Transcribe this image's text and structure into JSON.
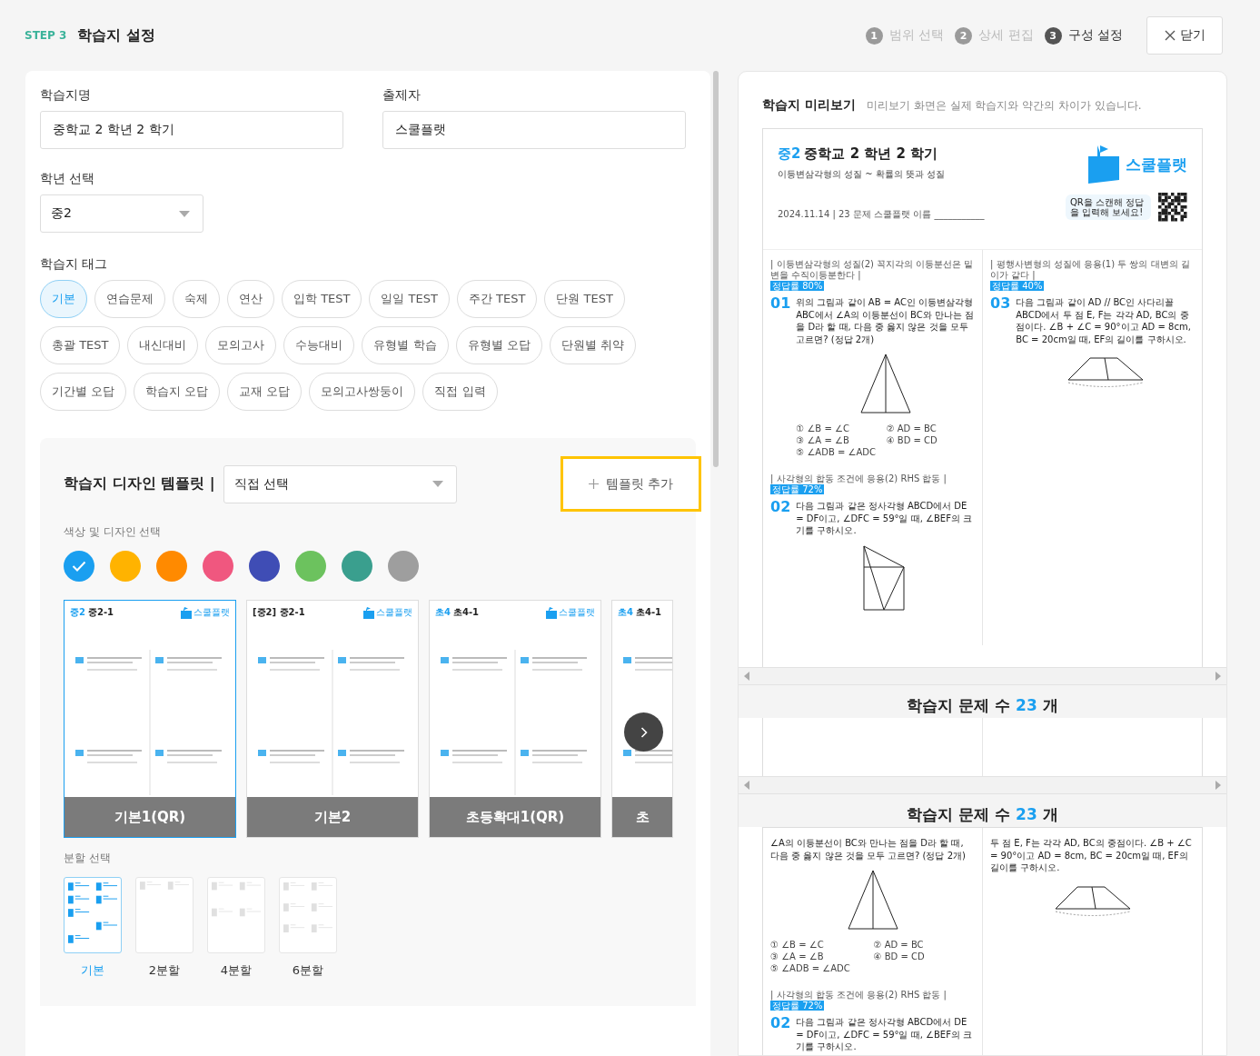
{
  "header": {
    "step": "STEP 3",
    "title": "학습지 설정",
    "steps": [
      {
        "number": "1",
        "label": "범위 선택",
        "selected": false
      },
      {
        "number": "2",
        "label": "상세 편집",
        "selected": false
      },
      {
        "number": "3",
        "label": "구성 설정",
        "selected": true
      }
    ],
    "close_button": "닫기"
  },
  "form": {
    "name_label": "학습지명",
    "name_value": "중학교 2 학년 2 학기",
    "author_label": "출제자",
    "author_value": "스쿨플랫",
    "grade_label": "학년 선택",
    "grade_value": "중2",
    "tags_label": "학습지 태그",
    "tags": [
      {
        "label": "기본",
        "selected": true
      },
      {
        "label": "연습문제",
        "selected": false
      },
      {
        "label": "숙제",
        "selected": false
      },
      {
        "label": "연산",
        "selected": false
      },
      {
        "label": "입학 TEST",
        "selected": false
      },
      {
        "label": "일일 TEST",
        "selected": false
      },
      {
        "label": "주간 TEST",
        "selected": false
      },
      {
        "label": "단원 TEST",
        "selected": false
      },
      {
        "label": "총괄 TEST",
        "selected": false
      },
      {
        "label": "내신대비",
        "selected": false
      },
      {
        "label": "모의고사",
        "selected": false
      },
      {
        "label": "수능대비",
        "selected": false
      },
      {
        "label": "유형별 학습",
        "selected": false
      },
      {
        "label": "유형별 오답",
        "selected": false
      },
      {
        "label": "단원별 취약",
        "selected": false
      },
      {
        "label": "기간별 오답",
        "selected": false
      },
      {
        "label": "학습지 오답",
        "selected": false
      },
      {
        "label": "교재 오답",
        "selected": false
      },
      {
        "label": "모의고사쌍둥이",
        "selected": false
      },
      {
        "label": "직접 입력",
        "selected": false
      }
    ]
  },
  "template": {
    "title": "학습지 디자인 템플릿 |",
    "select_value": "직접 선택",
    "add_button": "템플릿 추가",
    "add_highlighted": true,
    "color_label": "색상 및 디자인 선택",
    "colors": [
      {
        "color": "#1a9ff0",
        "selected": true
      },
      {
        "color": "#ffb300",
        "selected": false
      },
      {
        "color": "#ff8a00",
        "selected": false
      },
      {
        "color": "#f0577f",
        "selected": false
      },
      {
        "color": "#3f4db5",
        "selected": false
      },
      {
        "color": "#6cc25e",
        "selected": false
      },
      {
        "color": "#3a9f8e",
        "selected": false
      },
      {
        "color": "#9e9e9e",
        "selected": false
      }
    ],
    "designs": [
      {
        "label": "기본1(QR)",
        "grade": "중2",
        "title": "중2-1",
        "logo": "스쿨플랫",
        "selected": true
      },
      {
        "label": "기본2",
        "title": "[중2] 중2-1",
        "logo": "스쿨플랫",
        "selected": false
      },
      {
        "label": "초등확대1(QR)",
        "grade": "초4",
        "title": "초4-1",
        "logo": "스쿨플랫",
        "selected": false
      },
      {
        "label": "초",
        "grade": "초4",
        "title": "초4-1",
        "selected": false
      }
    ],
    "split_label": "분할 선택",
    "splits": [
      {
        "label": "기본",
        "kind": "basic",
        "selected": true
      },
      {
        "label": "2분할",
        "kind": "two",
        "selected": false
      },
      {
        "label": "4분할",
        "kind": "four",
        "selected": false
      },
      {
        "label": "6분할",
        "kind": "six",
        "selected": false
      }
    ]
  },
  "preview": {
    "title": "학습지 미리보기",
    "note": "미리보기 화면은 실제 학습지와 약간의 차이가 있습니다.",
    "sheet": {
      "grade": "중2",
      "title": "중학교 2 학년 2 학기",
      "subtitle": "이등변삼각형의 성질 ~ 확률의 뜻과 성질",
      "info": "2024.11.14 | 23 문제 스쿨플랫 이름 ___________",
      "logo": "스쿨플랫",
      "qr_caption": "QR을 스캔해 정답을 입력해 보세요!"
    },
    "columns": [
      [
        {
          "header": "| 이등변삼각형의 성질(2) 꼭지각의 이등분선은 밑변을 수직이등분한다 |",
          "badge": "정답률 80%",
          "number": "01",
          "text": "위의 그림과 같이 AB = AC인 이등변삼각형 ABC에서 ∠A의 이등분선이 BC와 만나는 점을 D라 할 때, 다음 중 옳지 않은 것을 모두 고르면? (정답 2개)",
          "figure": {
            "kind": "triangle"
          },
          "options": [
            "① ∠B = ∠C",
            "② AD = BC",
            "③ ∠A = ∠B",
            "④ BD = CD",
            "⑤ ∠ADB = ∠ADC"
          ]
        },
        {
          "header": "| 사각형의 합동 조건에 응용(2) RHS 합동 |",
          "badge": "정답률 72%",
          "number": "02",
          "text": "다음 그림과 같은 정사각형 ABCD에서 DE = DF이고, ∠DFC = 59°일 때, ∠BEF의 크기를 구하시오.",
          "figure": {
            "kind": "square"
          }
        }
      ],
      [
        {
          "header": "| 평행사변형의 성질에 응용(1) 두 쌍의 대변의 길이가 같다 |",
          "badge": "정답률 40%",
          "number": "03",
          "text": "다음 그림과 같이 AD // BC인 사다리꼴 ABCD에서 두 점 E, F는 각각 AD, BC의 중점이다. ∠B + ∠C = 90°이고 AD = 8cm, BC = 20cm일 때, EF의 길이를 구하시오.",
          "figure": {
            "kind": "trapezoid"
          }
        }
      ]
    ],
    "count": {
      "label": "학습지 문제 수",
      "value": "23",
      "unit": "개"
    },
    "repeat_count": {
      "label": "학습지 문제 수",
      "value": "23",
      "unit": "개"
    },
    "lower_columns": [
      [
        {
          "text": "∠A의 이등분선이 BC와 만나는 점을 D라 할 때, 다음 중 옳지 않은 것을 모두 고르면? (정답 2개)",
          "figure": {
            "kind": "triangle"
          },
          "options": [
            "① ∠B = ∠C",
            "② AD = BC",
            "③ ∠A = ∠B",
            "④ BD = CD",
            "⑤ ∠ADB = ∠ADC"
          ]
        },
        {
          "header": "| 사각형의 합동 조건에 응용(2) RHS 합동 |",
          "badge": "정답률 72%",
          "number": "02",
          "text": "다음 그림과 같은 정사각형 ABCD에서 DE = DF이고, ∠DFC = 59°일 때, ∠BEF의 크기를 구하시오."
        }
      ],
      [
        {
          "text": "두 점 E, F는 각각 AD, BC의 중점이다. ∠B + ∠C = 90°이고 AD = 8cm, BC = 20cm일 때, EF의 길이를 구하시오.",
          "figure": {
            "kind": "trapezoid"
          }
        }
      ]
    ]
  }
}
